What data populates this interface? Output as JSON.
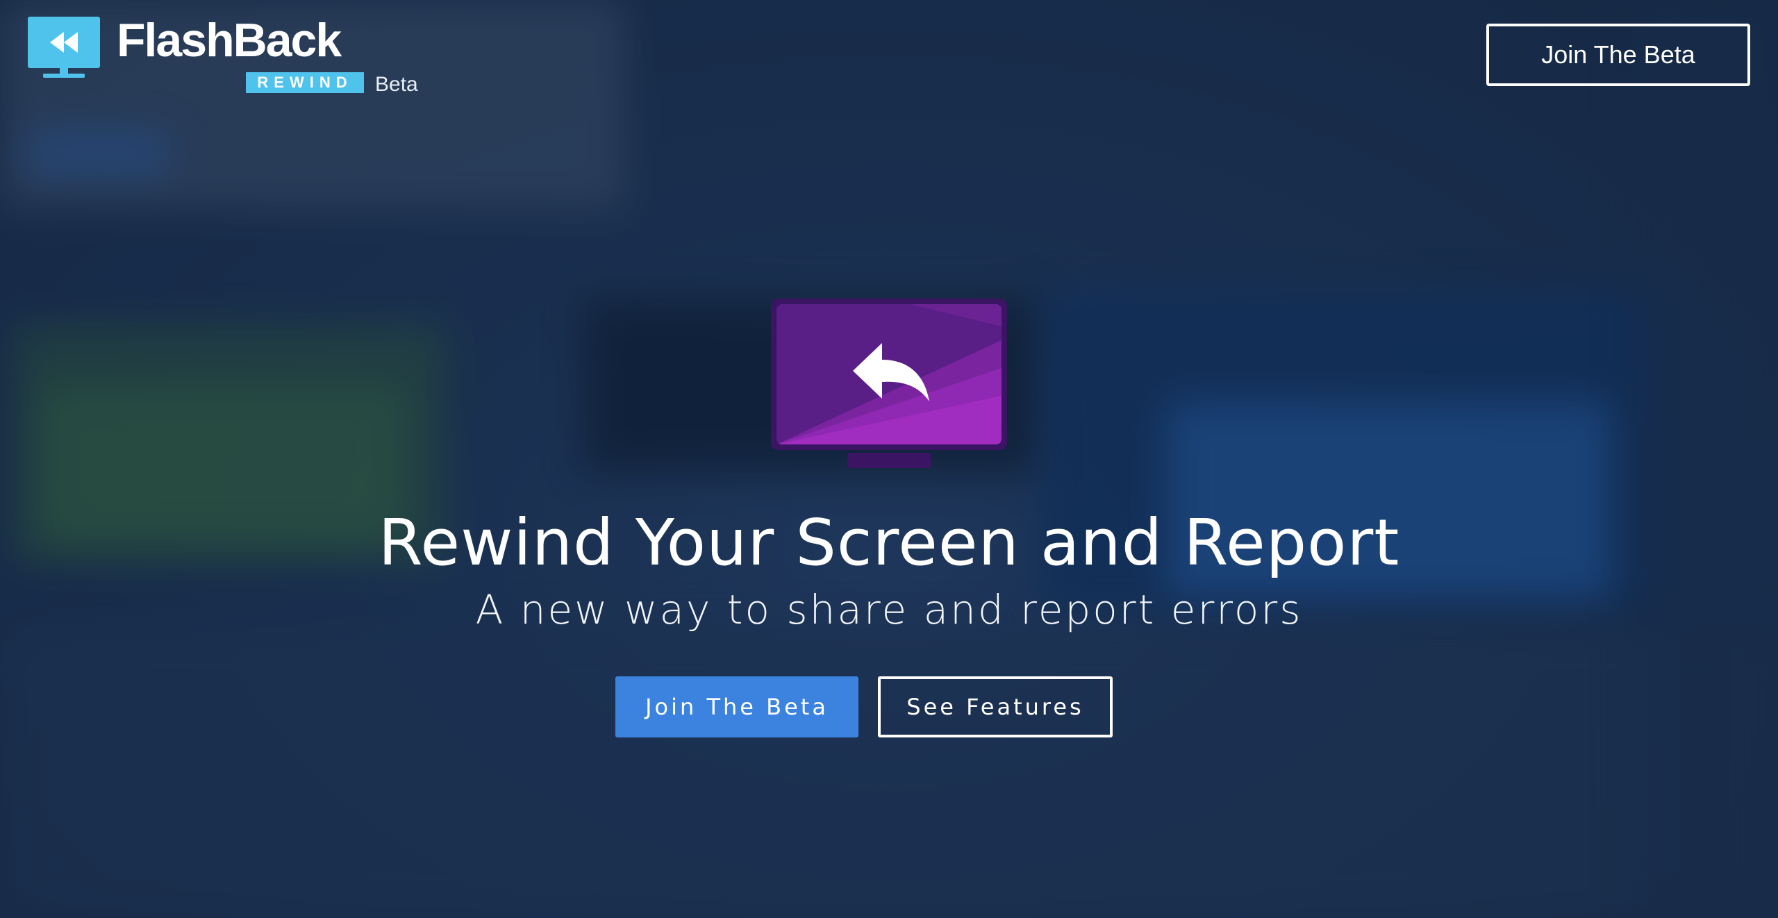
{
  "brand": {
    "name": "FlashBack",
    "tagline": "REWIND",
    "badge": "Beta",
    "logo_icon": "rewind-monitor-icon",
    "accent_color": "#4fc3ec"
  },
  "header": {
    "join_label": "Join The Beta"
  },
  "hero": {
    "icon": "rewind-monitor-icon",
    "icon_color": "#9a2cb8",
    "title": "Rewind Your Screen and Report",
    "subtitle": "A new way to share and report errors",
    "primary_button": "Join The Beta",
    "primary_color": "#3b83de",
    "secondary_button": "See Features"
  }
}
